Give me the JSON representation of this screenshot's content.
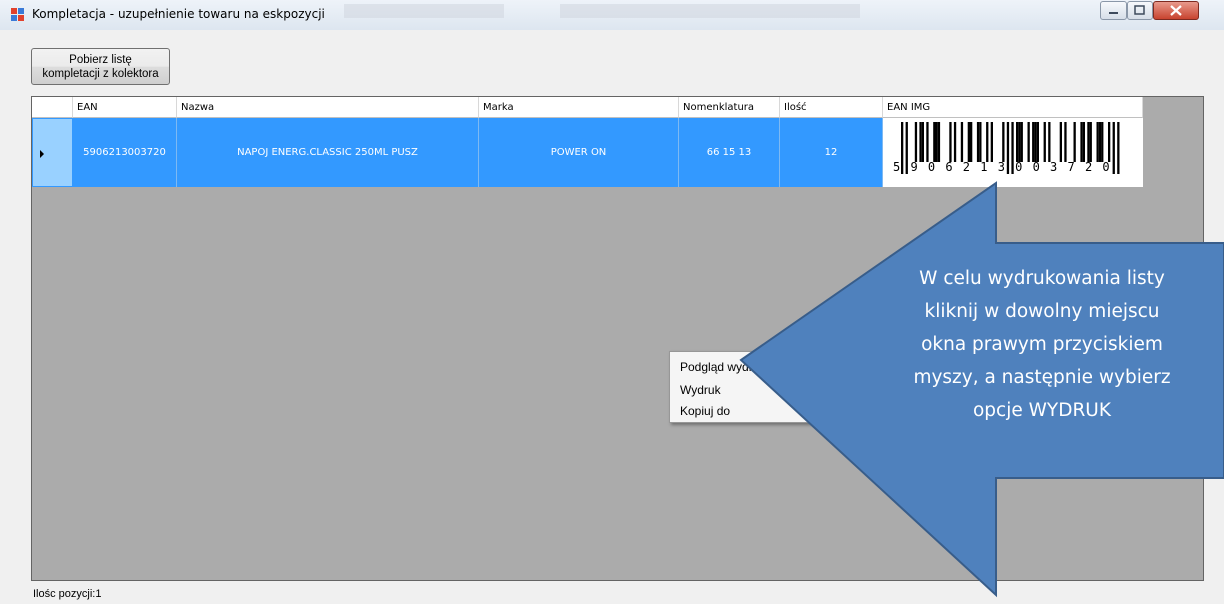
{
  "window": {
    "title": "Kompletacja - uzupełnienie towaru na eskpozycji"
  },
  "toolbar": {
    "fetch_button_line1": "Pobierz listę",
    "fetch_button_line2": "kompletacji z kolektora"
  },
  "grid": {
    "columns": [
      "EAN",
      "Nazwa",
      "Marka",
      "Nomenklatura",
      "Ilość",
      "EAN IMG"
    ],
    "rows": [
      {
        "ean": "5906213003720",
        "nazwa": "NAPOJ ENERG.CLASSIC 250ML PUSZ",
        "marka": "POWER ON",
        "nomenklatura": "66 15 13",
        "ilosc": "12",
        "barcode_digits": "5 9 0 6 2 1 3 0 0 3 7 2 0"
      }
    ],
    "row_selected": true
  },
  "status": {
    "text": "Ilośc pozycji:1"
  },
  "context_menu": {
    "items": [
      "Podgląd wydruku",
      "Wydruk",
      "Kopiuj do"
    ]
  },
  "callout": {
    "text": "W celu wydrukowania listy\nkliknij w dowolny miejscu\nokna prawym przyciskiem\nmyszy, a następnie wybierz\nopcje WYDRUK",
    "fill_color": "#4f81bd",
    "stroke_color": "#385d8a"
  }
}
